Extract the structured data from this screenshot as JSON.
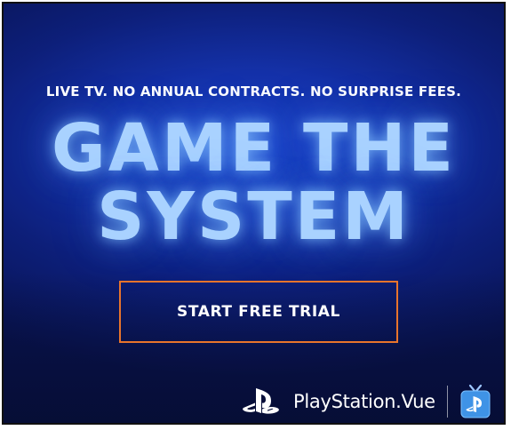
{
  "ad": {
    "tagline": "LIVE TV. NO ANNUAL CONTRACTS. NO SURPRISE FEES.",
    "headline_line1": "GAME THE",
    "headline_line2": "SYSTEM",
    "cta_label": "START FREE TRIAL",
    "brand_name": "PlayStation.Vue"
  },
  "icons": {
    "brand_logo": "playstation-logo-icon",
    "app_icon": "playstation-vue-tv-icon"
  },
  "colors": {
    "background": "#1431a8",
    "headline": "#a9d2ff",
    "cta_border": "#e8742c",
    "text": "#ffffff"
  }
}
